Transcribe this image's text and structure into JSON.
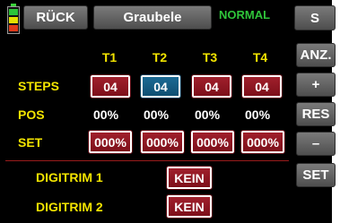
{
  "header": {
    "back_label": "RÜCK",
    "model_name": "Graubele",
    "mode_label": "NORMAL",
    "top_right_label": "S"
  },
  "columns": [
    "T1",
    "T2",
    "T3",
    "T4"
  ],
  "rows": {
    "steps": {
      "label": "STEPS",
      "values": [
        "04",
        "04",
        "04",
        "04"
      ]
    },
    "pos": {
      "label": "POS",
      "values": [
        "00%",
        "00%",
        "00%",
        "00%"
      ]
    },
    "set": {
      "label": "SET",
      "values": [
        "000%",
        "000%",
        "000%",
        "000%"
      ]
    }
  },
  "digitrim": [
    {
      "label": "DIGITRIM 1",
      "value": "KEIN"
    },
    {
      "label": "DIGITRIM 2",
      "value": "KEIN"
    }
  ],
  "side_buttons": {
    "anz": "ANZ.",
    "plus": "+",
    "res": "RES",
    "minus": "–",
    "set": "SET"
  },
  "colors": {
    "background": "#000000",
    "accent_yellow": "#f3e400",
    "mode_green": "#2fc43a",
    "value_red": "#8e1822",
    "selected_blue": "#155f86",
    "separator": "#9a1c1c"
  },
  "battery_icon": "battery-icon"
}
